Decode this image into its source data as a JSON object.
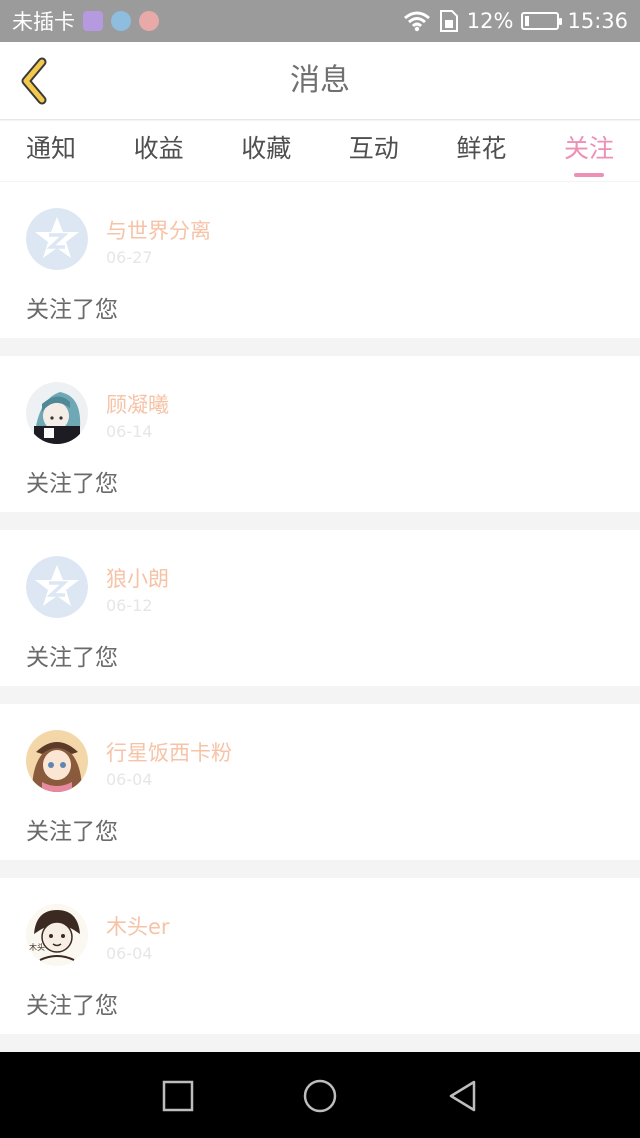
{
  "status_bar": {
    "carrier": "未插卡",
    "battery_percent": "12%",
    "battery_level": 0.12,
    "time": "15:36",
    "app_icons": [
      "gallery-icon",
      "bird-app-icon",
      "store-app-icon"
    ]
  },
  "header": {
    "title": "消息",
    "back_icon": "chevron-left-icon",
    "back_color": "#f2c94c"
  },
  "tabs": [
    {
      "label": "通知"
    },
    {
      "label": "收益"
    },
    {
      "label": "收藏"
    },
    {
      "label": "互动"
    },
    {
      "label": "鲜花"
    },
    {
      "label": "关注",
      "active": true
    }
  ],
  "accent_color": "#ee8fb5",
  "follows": [
    {
      "name": "与世界分离",
      "date": "06-27",
      "message": "关注了您",
      "avatar": "default-qq-avatar"
    },
    {
      "name": "顾凝曦",
      "date": "06-14",
      "message": "关注了您",
      "avatar": "anime-girl-avatar"
    },
    {
      "name": "狼小朗",
      "date": "06-12",
      "message": "关注了您",
      "avatar": "default-qq-avatar"
    },
    {
      "name": "行星饭西卡粉",
      "date": "06-04",
      "message": "关注了您",
      "avatar": "anime-girl-hat-avatar"
    },
    {
      "name": "木头er",
      "date": "06-04",
      "message": "关注了您",
      "avatar": "sketch-avatar"
    }
  ],
  "nav_bar": {
    "buttons": [
      "recent-apps-icon",
      "home-icon",
      "back-triangle-icon"
    ]
  }
}
